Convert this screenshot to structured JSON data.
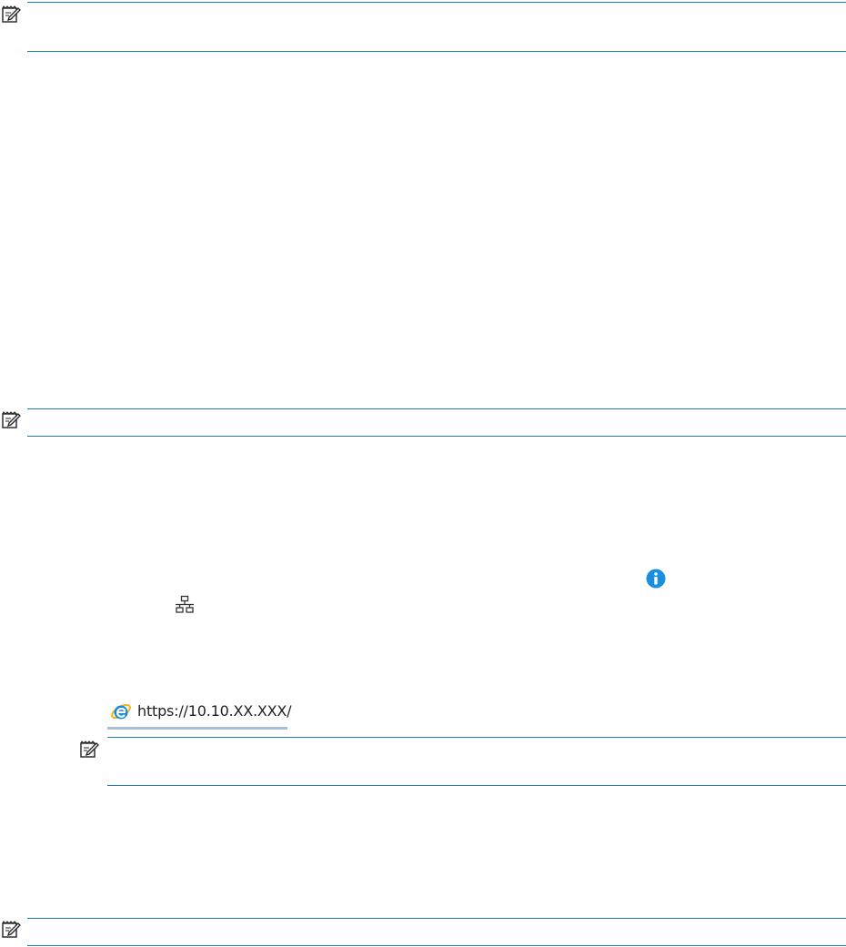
{
  "browser_address_bar": {
    "url": "https://10.10.XX.XXX/"
  },
  "icons": {
    "note": "note-pencil-icon",
    "info": "info-icon",
    "network": "network-icon",
    "browser": "internet-explorer-icon"
  },
  "colors": {
    "rule": "#1a7fb0",
    "info_icon": "#1a8fe0",
    "ie_blue": "#1e88d8",
    "ie_ring": "#f0b41a",
    "address_bar_border": "#a8bfd6"
  }
}
